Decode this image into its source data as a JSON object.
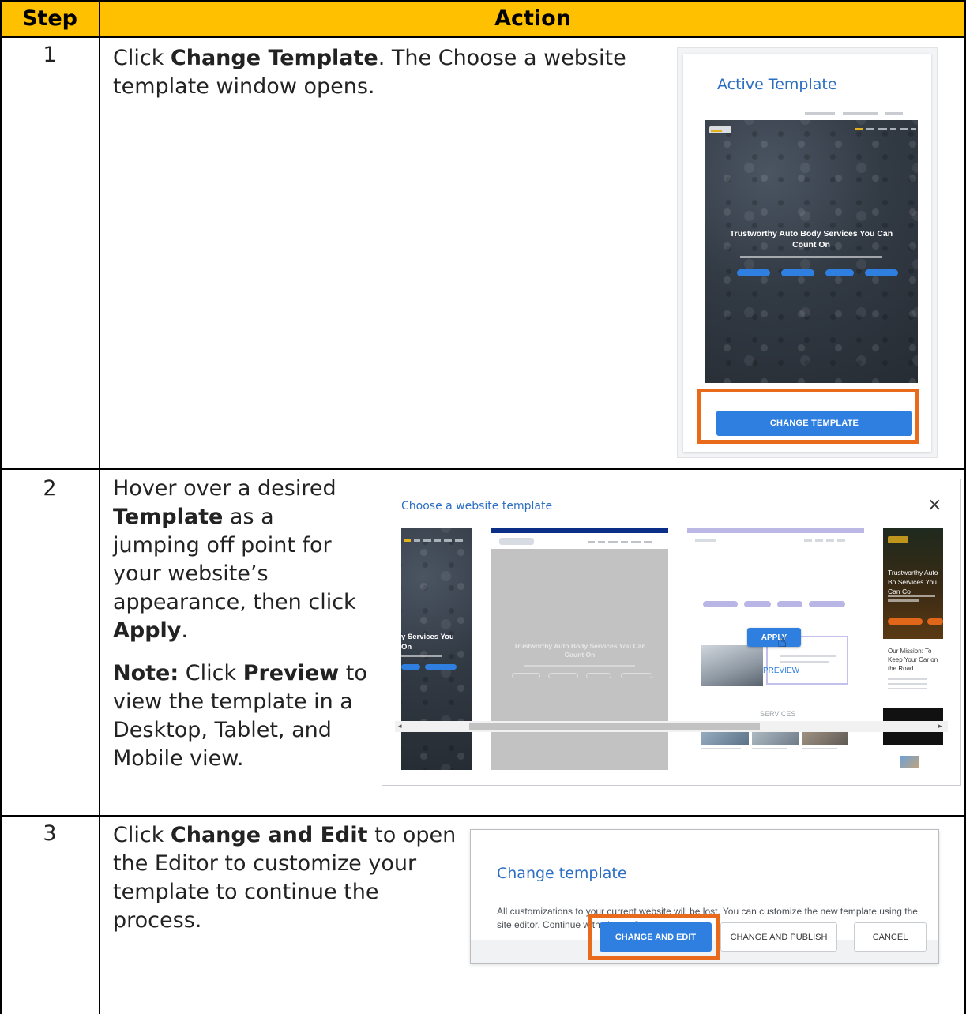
{
  "table": {
    "header_step": "Step",
    "header_action": "Action"
  },
  "steps": [
    {
      "number": "1",
      "text": {
        "t1": "Click ",
        "b1": "Change Template",
        "t2": ". The Choose a website template window opens."
      }
    },
    {
      "number": "2",
      "text": {
        "t1": "Hover over a desired ",
        "b1": "Template",
        "t2": " as a jumping off point for your website’s appearance, then click ",
        "b2": "Apply",
        "t3": "."
      },
      "note": {
        "label": "Note:",
        "t1": " Click ",
        "b1": "Preview",
        "t2": " to view the template in a Desktop, Tablet, and Mobile view."
      }
    },
    {
      "number": "3",
      "text": {
        "t1": "Click ",
        "b1": "Change and Edit",
        "t2": " to open the Editor to customize your template to continue the process."
      }
    }
  ],
  "screenshot_active_template": {
    "title": "Active Template",
    "thumbnail_headline": "Trustworthy Auto Body Services You Can Count On",
    "change_button": "CHANGE TEMPLATE"
  },
  "screenshot_choose_template": {
    "title": "Choose a website template",
    "close_icon": "×",
    "left_thumb_headline_1": "y Services You",
    "left_thumb_headline_2": "On",
    "center_thumb_headline": "Trustworthy Auto Body Services You Can Count On",
    "apply_button": "APPLY",
    "preview_link": "PREVIEW",
    "services_label": "SERVICES",
    "right_thumb_headline": "Trustworthy Auto Bo Services You Can Co",
    "right_thumb_mission": "Our Mission: To Keep Your Car on the Road",
    "scroll_left": "◂",
    "scroll_right": "▸"
  },
  "screenshot_change_dialog": {
    "title": "Change template",
    "body": "All customizations to your current website will be lost. You can customize the new template using the site editor. Continue with change?",
    "btn_change_edit": "CHANGE AND EDIT",
    "btn_change_publish": "CHANGE AND PUBLISH",
    "btn_cancel": "CANCEL"
  },
  "colors": {
    "header_fill": "#ffc000",
    "highlight_box": "#ea6a1c",
    "primary_button": "#2e7fe0",
    "dialog_title": "#2c6fc2"
  }
}
